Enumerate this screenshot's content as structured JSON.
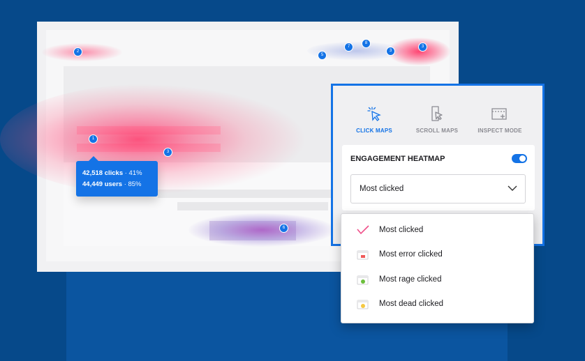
{
  "heatmap_markers": [
    "2",
    "7",
    "8",
    "5",
    "3",
    "3",
    "1",
    "3",
    "6"
  ],
  "tooltip": {
    "clicks": "42,518 clicks",
    "clicks_pct": "· 41%",
    "users": "44,449 users",
    "users_pct": "· 85%"
  },
  "panel": {
    "tabs": [
      {
        "label": "CLICK MAPS",
        "icon": "click-pointer-icon",
        "active": true
      },
      {
        "label": "SCROLL MAPS",
        "icon": "scroll-page-icon",
        "active": false
      },
      {
        "label": "INSPECT MODE",
        "icon": "inspect-window-icon",
        "active": false
      }
    ],
    "engagement_title": "ENGAGEMENT HEATMAP",
    "toggle_on": true,
    "selected_option": "Most clicked"
  },
  "dropdown": {
    "options": [
      {
        "label": "Most clicked",
        "icon": "checkmark-icon",
        "selected": true
      },
      {
        "label": "Most error clicked",
        "icon": "error-window-icon"
      },
      {
        "label": "Most rage clicked",
        "icon": "rage-window-icon"
      },
      {
        "label": "Most dead clicked",
        "icon": "dead-window-icon"
      }
    ]
  },
  "colors": {
    "accent": "#1473e6",
    "heat": "#ff3c6e",
    "background": "#06498a"
  }
}
